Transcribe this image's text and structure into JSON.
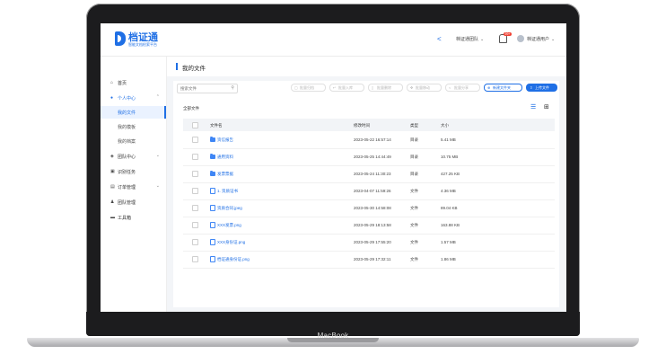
{
  "device": {
    "brand": "MacBook"
  },
  "app": {
    "logo_title": "档证通",
    "logo_sub": "智能文档检索平台"
  },
  "topbar": {
    "share_icon": "share-icon",
    "team_label": "档证通团队",
    "bell_badge": "99+",
    "user_label": "档证通用户"
  },
  "sidebar": {
    "items": [
      {
        "label": "首页",
        "icon": "home-icon",
        "arrow": ""
      },
      {
        "label": "个人中心",
        "icon": "user-icon",
        "arrow": "⌃"
      },
      {
        "label": "我的文件",
        "icon": "",
        "arrow": ""
      },
      {
        "label": "我的模板",
        "icon": "",
        "arrow": ""
      },
      {
        "label": "我的档案",
        "icon": "",
        "arrow": ""
      },
      {
        "label": "团队中心",
        "icon": "team-icon",
        "arrow": "⌄"
      },
      {
        "label": "识别任务",
        "icon": "scan-icon",
        "arrow": ""
      },
      {
        "label": "订单管理",
        "icon": "order-icon",
        "arrow": "⌄"
      },
      {
        "label": "团队管理",
        "icon": "group-icon",
        "arrow": ""
      },
      {
        "label": "工具箱",
        "icon": "toolbox-icon",
        "arrow": ""
      }
    ]
  },
  "page": {
    "title": "我的文件"
  },
  "toolbar": {
    "search_placeholder": "搜索文件",
    "buttons": [
      "批量归档",
      "批量入库",
      "批量删除",
      "批量移动",
      "批量分享"
    ],
    "new_folder": "新建文件夹",
    "upload": "上传文件"
  },
  "breadcrumb": "全部文件",
  "table": {
    "headers": {
      "name": "文件名",
      "time": "修改时间",
      "type": "类型",
      "size": "大小"
    },
    "rows": [
      {
        "kind": "folder",
        "name": "资信报告",
        "time": "2023-05-22 16:57:14",
        "type": "目录",
        "size": "5.41 MB"
      },
      {
        "kind": "folder",
        "name": "通用资料",
        "time": "2023-05-25 14:44:49",
        "type": "目录",
        "size": "10.75 MB"
      },
      {
        "kind": "folder",
        "name": "发票票据",
        "time": "2023-05-24 11:30:23",
        "type": "目录",
        "size": "427.25 KB"
      },
      {
        "kind": "file",
        "name": "1. 资质证书",
        "time": "2023-04-07 11:59:26",
        "type": "文件",
        "size": "4.36 MB"
      },
      {
        "kind": "file",
        "name": "资质合同.jpeg",
        "time": "2023-05-30 14:58:08",
        "type": "文件",
        "size": "89.04 KB"
      },
      {
        "kind": "file",
        "name": "XXX发票.png",
        "time": "2023-05-29 18:13:58",
        "type": "文件",
        "size": "163.88 KB"
      },
      {
        "kind": "file",
        "name": "XXX身份证.png",
        "time": "2023-05-29 17:55:20",
        "type": "文件",
        "size": "1.57 MB"
      },
      {
        "kind": "file",
        "name": "档证通身份证.png",
        "time": "2023-05-29 17:32:11",
        "type": "文件",
        "size": "1.86 MB"
      }
    ]
  }
}
